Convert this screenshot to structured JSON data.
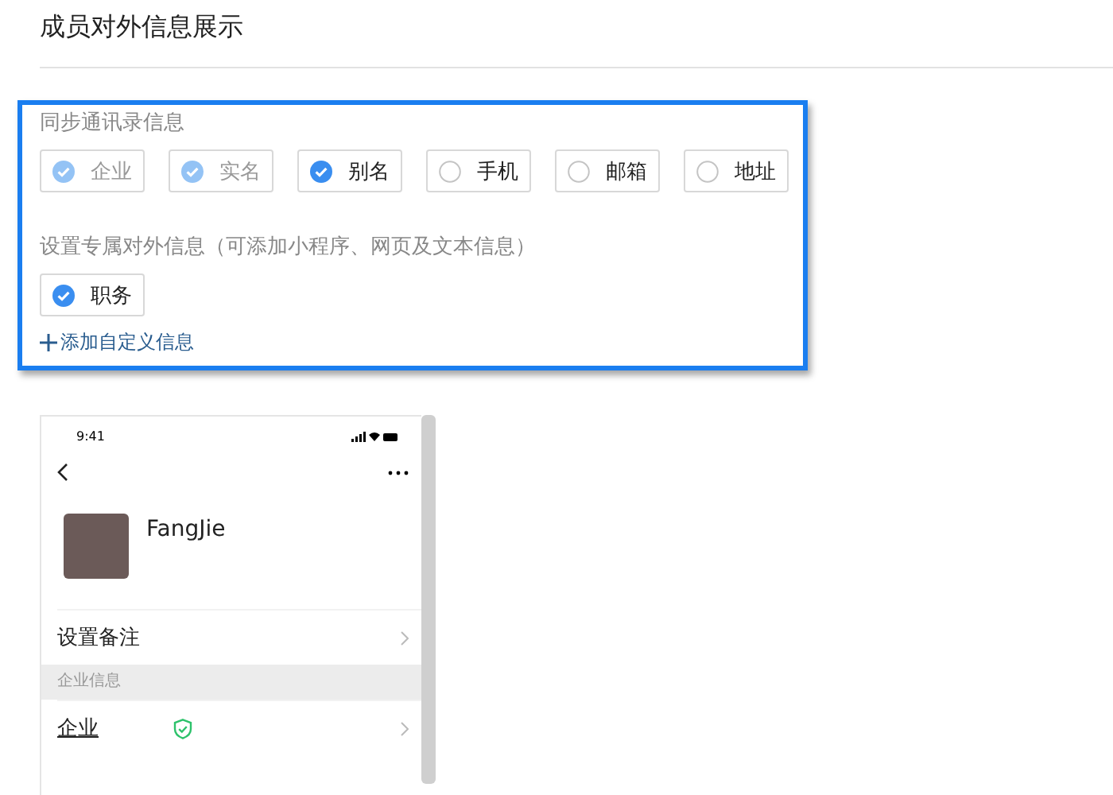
{
  "title": "成员对外信息展示",
  "sync_section": {
    "label": "同步通讯录信息",
    "options": [
      {
        "label": "企业",
        "checked": true,
        "disabled": true
      },
      {
        "label": "实名",
        "checked": true,
        "disabled": true
      },
      {
        "label": "别名",
        "checked": true,
        "disabled": false
      },
      {
        "label": "手机",
        "checked": false,
        "disabled": false
      },
      {
        "label": "邮箱",
        "checked": false,
        "disabled": false
      },
      {
        "label": "地址",
        "checked": false,
        "disabled": false
      }
    ]
  },
  "custom_section": {
    "label": "设置专属对外信息（可添加小程序、网页及文本信息）",
    "options": [
      {
        "label": "职务",
        "checked": true,
        "disabled": false
      }
    ],
    "add_link": "添加自定义信息"
  },
  "phone_preview": {
    "time": "9:41",
    "name": "FangJie",
    "remark_row": "设置备注",
    "section_header": "企业信息",
    "company_row": "企业"
  }
}
